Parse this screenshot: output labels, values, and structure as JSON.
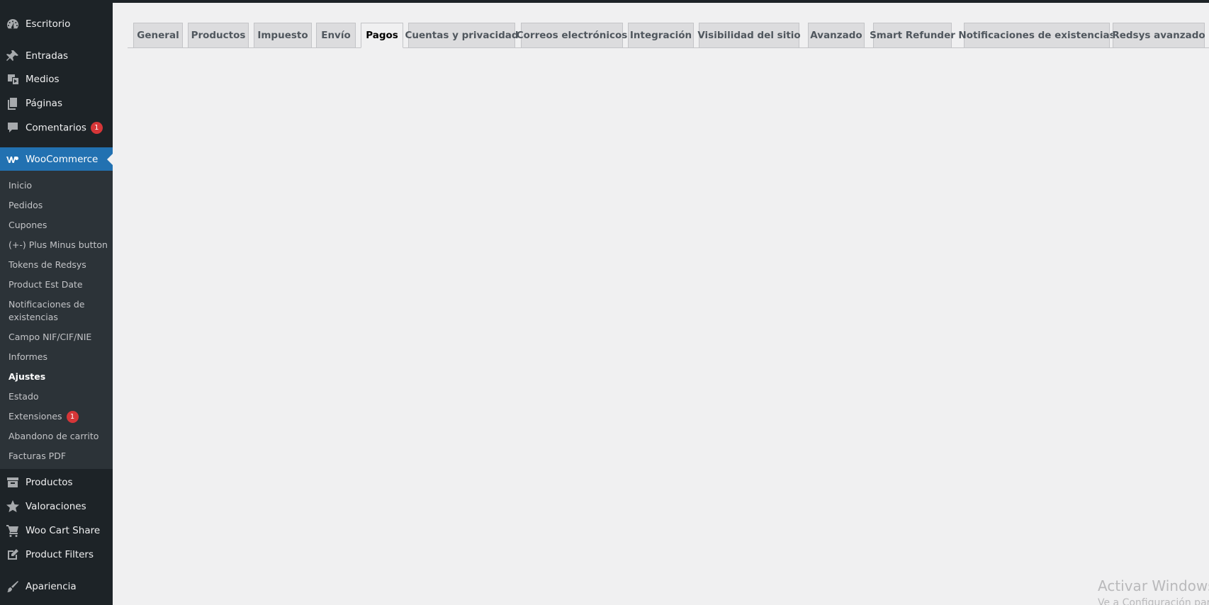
{
  "sidebar": {
    "top_items": [
      {
        "label": "Escritorio",
        "icon": "dashboard-icon"
      },
      {
        "label": "Entradas",
        "icon": "pin-icon"
      },
      {
        "label": "Medios",
        "icon": "media-icon"
      },
      {
        "label": "Páginas",
        "icon": "pages-icon"
      },
      {
        "label": "Comentarios",
        "icon": "comment-icon",
        "badge": "1"
      }
    ],
    "active_item": {
      "label": "WooCommerce",
      "icon": "woocommerce-icon"
    },
    "submenu": [
      {
        "label": "Inicio"
      },
      {
        "label": "Pedidos"
      },
      {
        "label": "Cupones"
      },
      {
        "label": "(+-) Plus Minus button"
      },
      {
        "label": "Tokens de Redsys"
      },
      {
        "label": "Product Est Date"
      },
      {
        "label": "Notificaciones de existencias"
      },
      {
        "label": "Campo NIF/CIF/NIE"
      },
      {
        "label": "Informes"
      },
      {
        "label": "Ajustes",
        "current": true
      },
      {
        "label": "Estado"
      },
      {
        "label": "Extensiones",
        "badge": "1"
      },
      {
        "label": "Abandono de carrito"
      },
      {
        "label": "Facturas PDF"
      }
    ],
    "bottom_items": [
      {
        "label": "Productos",
        "icon": "archive-icon"
      },
      {
        "label": "Valoraciones",
        "icon": "star-icon"
      },
      {
        "label": "Woo Cart Share",
        "icon": "cart-icon"
      },
      {
        "label": "Product Filters",
        "icon": "edit-icon"
      },
      {
        "label": "Apariencia",
        "icon": "brush-icon"
      }
    ]
  },
  "tabs": [
    {
      "label": "General"
    },
    {
      "label": "Productos"
    },
    {
      "label": "Impuesto"
    },
    {
      "label": "Envío"
    },
    {
      "label": "Pagos",
      "active": true
    },
    {
      "label": "Cuentas y privacidad"
    },
    {
      "label": "Correos electrónicos"
    },
    {
      "label": "Integración"
    },
    {
      "label": "Visibilidad del sitio"
    },
    {
      "label": "Avanzado"
    },
    {
      "label": "Smart Refunder"
    },
    {
      "label": "Notificaciones de existencias"
    },
    {
      "label": "Redsys avanzado"
    }
  ],
  "watermark": {
    "title": "Activar Windows",
    "subtitle": "Ve a Configuración para"
  },
  "colors": {
    "sidebar_bg": "#1d2327",
    "submenu_bg": "#2c3338",
    "accent": "#2271b1",
    "badge": "#d63638",
    "content_bg": "#f0f0f1"
  }
}
